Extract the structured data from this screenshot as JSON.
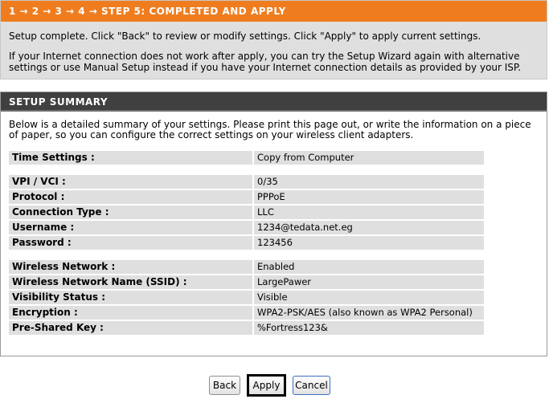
{
  "step": {
    "header": "1 → 2 → 3 → 4 → STEP 5: COMPLETED AND APPLY",
    "line1": "Setup complete. Click \"Back\" to review or modify settings. Click \"Apply\" to apply current settings.",
    "line2": "If your Internet connection does not work after apply, you can try the Setup Wizard again with alternative settings or use Manual Setup instead if you have your Internet connection details as provided by your ISP."
  },
  "summary": {
    "header": "SETUP SUMMARY",
    "intro": "Below is a detailed summary of your settings. Please print this page out, or write the information on a piece of paper, so you can configure the correct settings on your wireless client adapters.",
    "time": [
      {
        "label": "Time Settings :",
        "value": "Copy from Computer"
      }
    ],
    "connection": [
      {
        "label": "VPI / VCI :",
        "value": "0/35"
      },
      {
        "label": "Protocol :",
        "value": "PPPoE"
      },
      {
        "label": "Connection Type :",
        "value": "LLC"
      },
      {
        "label": "Username :",
        "value": "1234@tedata.net.eg"
      },
      {
        "label": "Password :",
        "value": "123456"
      }
    ],
    "wireless": [
      {
        "label": "Wireless Network :",
        "value": "Enabled"
      },
      {
        "label": "Wireless Network Name (SSID) :",
        "value": "LargePawer"
      },
      {
        "label": "Visibility Status :",
        "value": "Visible"
      },
      {
        "label": "Encryption :",
        "value": "WPA2-PSK/AES (also known as WPA2 Personal)"
      },
      {
        "label": "Pre-Shared Key :",
        "value": "%Fortress123&"
      }
    ]
  },
  "buttons": {
    "back": "Back",
    "apply": "Apply",
    "cancel": "Cancel"
  }
}
